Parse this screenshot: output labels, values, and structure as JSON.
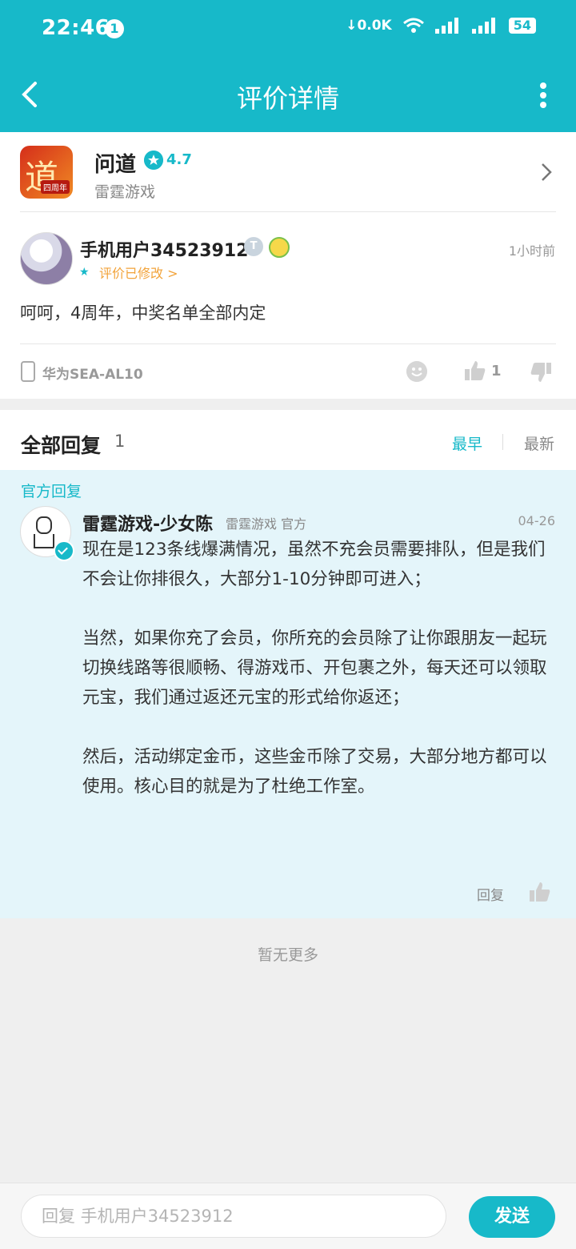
{
  "status_bar": {
    "time": "22:46",
    "notification_count": "1",
    "network_speed": "0.0K",
    "battery": "54"
  },
  "header": {
    "title": "评价详情"
  },
  "app": {
    "name": "问道",
    "rating": "4.7",
    "developer": "雷霆游戏"
  },
  "review": {
    "user_name": "手机用户34523912",
    "badge_letter": "T",
    "time_ago": "1小时前",
    "status": "评价已修改 >",
    "content": "呵呵，4周年，中奖名单全部内定",
    "device": "华为SEA-AL10",
    "like_count": "1"
  },
  "replies": {
    "title": "全部回复",
    "count": "1",
    "sort_earliest": "最早",
    "sort_latest": "最新"
  },
  "official_reply": {
    "label": "官方回复",
    "author": "雷霆游戏-少女陈",
    "meta": "雷霆游戏 官方",
    "date": "04-26",
    "paragraphs": [
      "现在是123条线爆满情况，虽然不充会员需要排队，但是我们不会让你排很久，大部分1-10分钟即可进入；",
      "当然，如果你充了会员，你所充的会员除了让你跟朋友一起玩切换线路等很顺畅、得游戏币、开包裹之外，每天还可以领取元宝，我们通过返还元宝的形式给你返还；",
      "然后，活动绑定金币，这些金币除了交易，大部分地方都可以使用。核心目的就是为了杜绝工作室。"
    ],
    "reply_label": "回复"
  },
  "footer": {
    "no_more": "暂无更多",
    "input_placeholder": "回复 手机用户34523912",
    "send_label": "发送"
  },
  "colors": {
    "accent": "#17b9c9",
    "orange": "#f2a33a",
    "official_bg": "#e4f5fa"
  }
}
